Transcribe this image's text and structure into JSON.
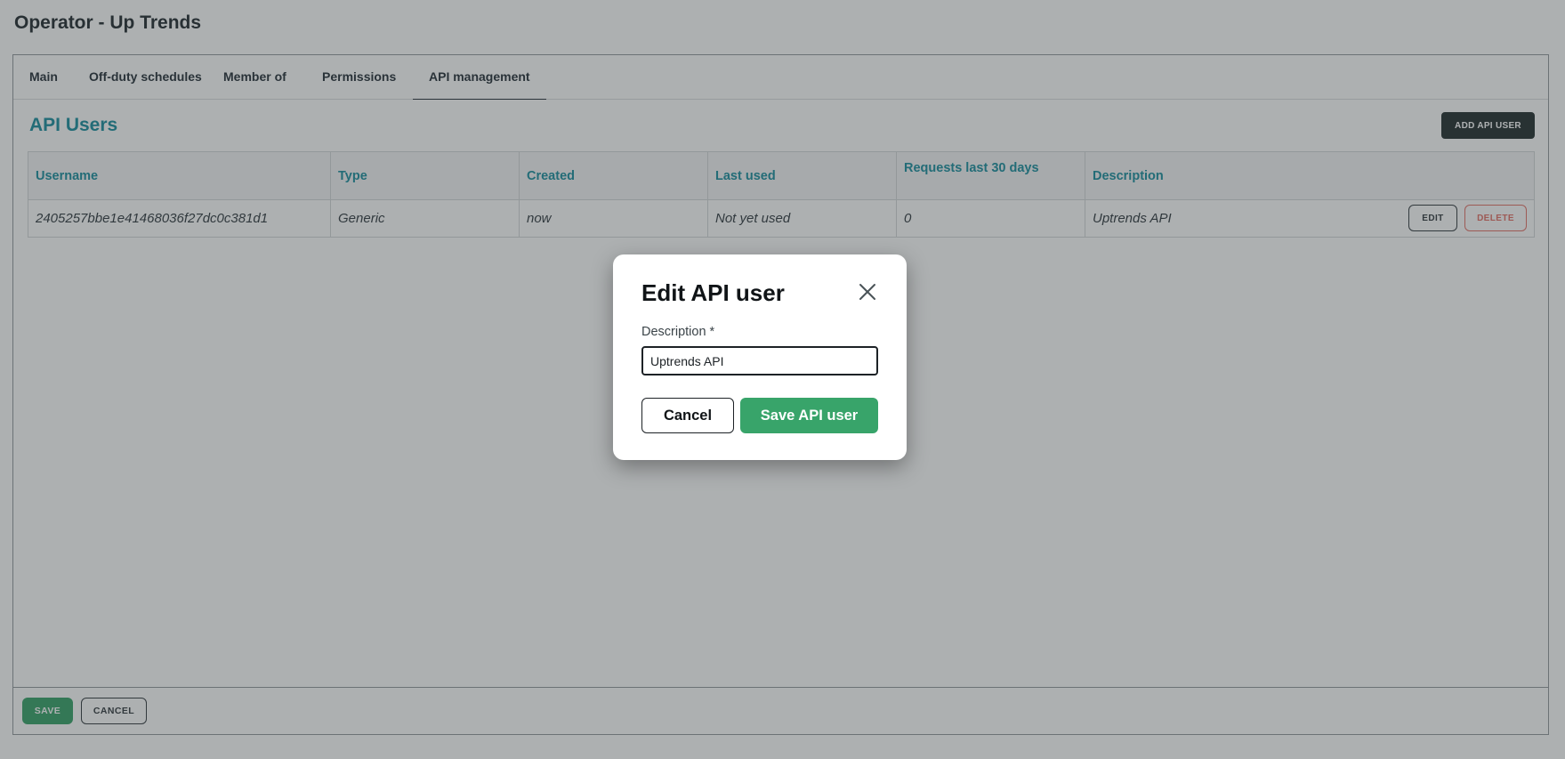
{
  "page": {
    "title": "Operator - Up Trends"
  },
  "tabs": [
    {
      "label": "Main"
    },
    {
      "label": "Off-duty schedules"
    },
    {
      "label": "Member of"
    },
    {
      "label": "Permissions"
    },
    {
      "label": "API management",
      "active": true
    }
  ],
  "api_users": {
    "title": "API Users",
    "add_button": "ADD API USER",
    "columns": [
      "Username",
      "Type",
      "Created",
      "Last used",
      "Requests last 30 days",
      "Description"
    ],
    "rows": [
      {
        "username": "2405257bbe1e41468036f27dc0c381d1",
        "type": "Generic",
        "created": "now",
        "last_used": "Not yet used",
        "requests": "0",
        "description": "Uptrends API",
        "edit_label": "EDIT",
        "delete_label": "DELETE"
      }
    ]
  },
  "footer": {
    "save_label": "SAVE",
    "cancel_label": "CANCEL"
  },
  "modal": {
    "title": "Edit API user",
    "field_label": "Description *",
    "field_value": "Uptrends API",
    "cancel_label": "Cancel",
    "save_label": "Save API user"
  },
  "colors": {
    "accent_teal": "#128a9b",
    "primary_green": "#38a46a",
    "danger_red": "#e36b61",
    "dark_button": "#1b2627"
  },
  "icons": {
    "modal_close": "close-icon"
  }
}
